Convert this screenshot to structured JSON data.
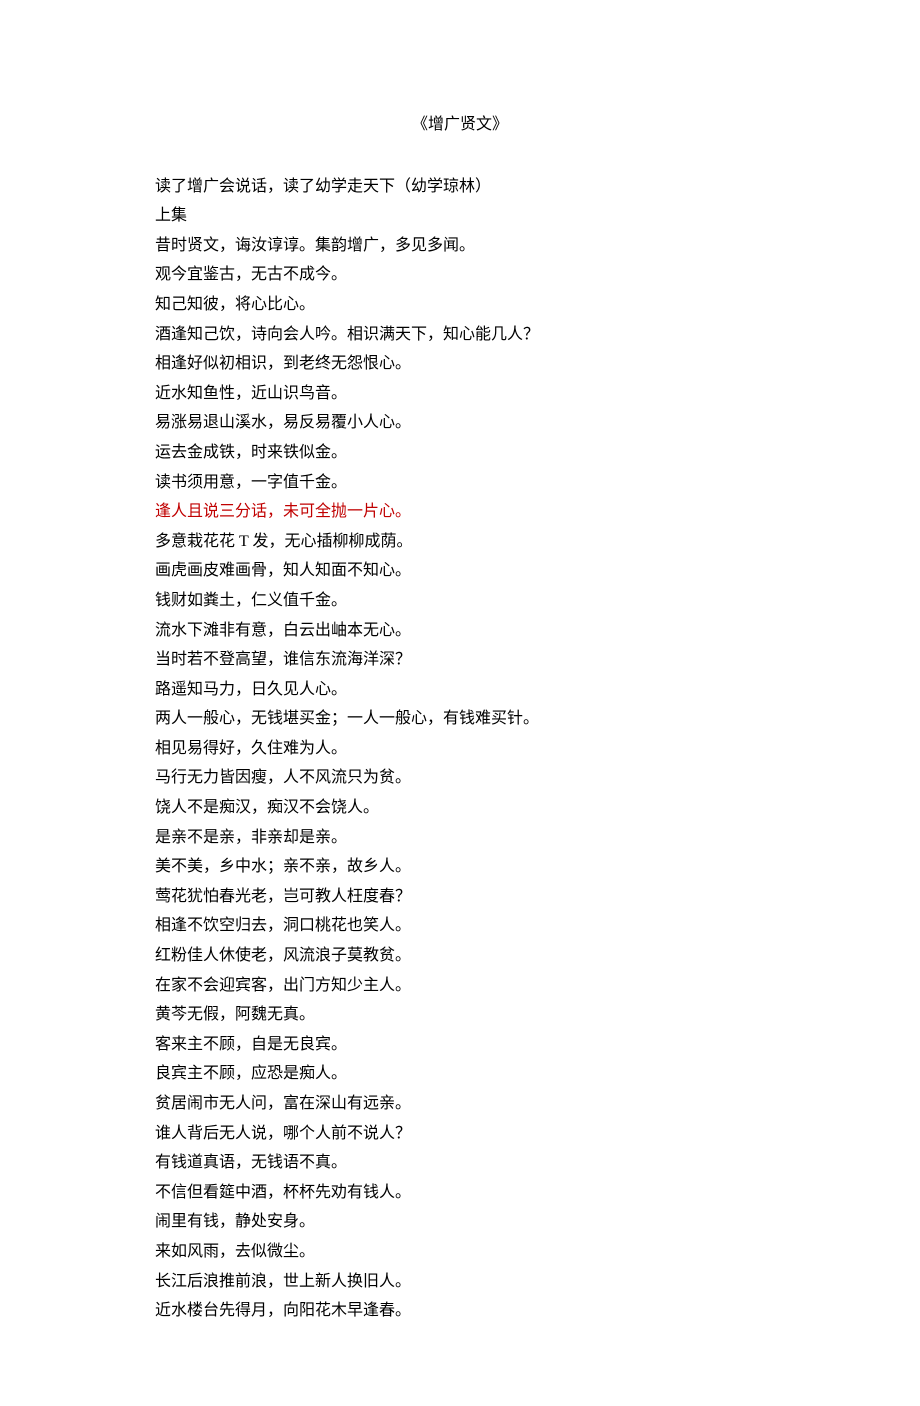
{
  "title": "《增广贤文》",
  "lines": [
    {
      "text": "读了增广会说话，读了幼学走天下（幼学琼林）",
      "highlight": false
    },
    {
      "text": "上集",
      "highlight": false
    },
    {
      "text": "昔时贤文，诲汝谆谆。集韵增广，多见多闻。",
      "highlight": false
    },
    {
      "text": "观今宜鉴古，无古不成今。",
      "highlight": false
    },
    {
      "text": "知己知彼，将心比心。",
      "highlight": false
    },
    {
      "text": "酒逢知己饮，诗向会人吟。相识满天下，知心能几人？",
      "highlight": false
    },
    {
      "text": "相逢好似初相识，到老终无怨恨心。",
      "highlight": false
    },
    {
      "text": "近水知鱼性，近山识鸟音。",
      "highlight": false
    },
    {
      "text": "易涨易退山溪水，易反易覆小人心。",
      "highlight": false
    },
    {
      "text": "运去金成铁，时来铁似金。",
      "highlight": false
    },
    {
      "text": "读书须用意，一字值千金。",
      "highlight": false
    },
    {
      "text": "逢人且说三分话，未可全抛一片心。",
      "highlight": true
    },
    {
      "text": "多意栽花花 T 发，无心插柳柳成荫。",
      "highlight": false
    },
    {
      "text": "画虎画皮难画骨，知人知面不知心。",
      "highlight": false
    },
    {
      "text": "钱财如粪土，仁义值千金。",
      "highlight": false
    },
    {
      "text": "流水下滩非有意，白云出岫本无心。",
      "highlight": false
    },
    {
      "text": "当时若不登高望，谁信东流海洋深？",
      "highlight": false
    },
    {
      "text": "路遥知马力，日久见人心。",
      "highlight": false
    },
    {
      "text": "两人一般心，无钱堪买金；一人一般心，有钱难买针。",
      "highlight": false
    },
    {
      "text": "相见易得好，久住难为人。",
      "highlight": false
    },
    {
      "text": "马行无力皆因瘦，人不风流只为贫。",
      "highlight": false
    },
    {
      "text": "饶人不是痴汉，痴汉不会饶人。",
      "highlight": false
    },
    {
      "text": "是亲不是亲，非亲却是亲。",
      "highlight": false
    },
    {
      "text": "美不美，乡中水；亲不亲，故乡人。",
      "highlight": false
    },
    {
      "text": "莺花犹怕春光老，岂可教人枉度春？",
      "highlight": false
    },
    {
      "text": "相逢不饮空归去，洞口桃花也笑人。",
      "highlight": false
    },
    {
      "text": "红粉佳人休使老，风流浪子莫教贫。",
      "highlight": false
    },
    {
      "text": "在家不会迎宾客，出门方知少主人。",
      "highlight": false
    },
    {
      "text": "黄芩无假，阿魏无真。",
      "highlight": false
    },
    {
      "text": "客来主不顾，自是无良宾。",
      "highlight": false
    },
    {
      "text": "良宾主不顾，应恐是痴人。",
      "highlight": false
    },
    {
      "text": "贫居闹市无人问，富在深山有远亲。",
      "highlight": false
    },
    {
      "text": "谁人背后无人说，哪个人前不说人？",
      "highlight": false
    },
    {
      "text": "有钱道真语，无钱语不真。",
      "highlight": false
    },
    {
      "text": "不信但看筵中酒，杯杯先劝有钱人。",
      "highlight": false
    },
    {
      "text": "闹里有钱，静处安身。",
      "highlight": false
    },
    {
      "text": "来如风雨，去似微尘。",
      "highlight": false
    },
    {
      "text": "长江后浪推前浪，世上新人换旧人。",
      "highlight": false
    },
    {
      "text": "近水楼台先得月，向阳花木早逢春。",
      "highlight": false
    }
  ]
}
